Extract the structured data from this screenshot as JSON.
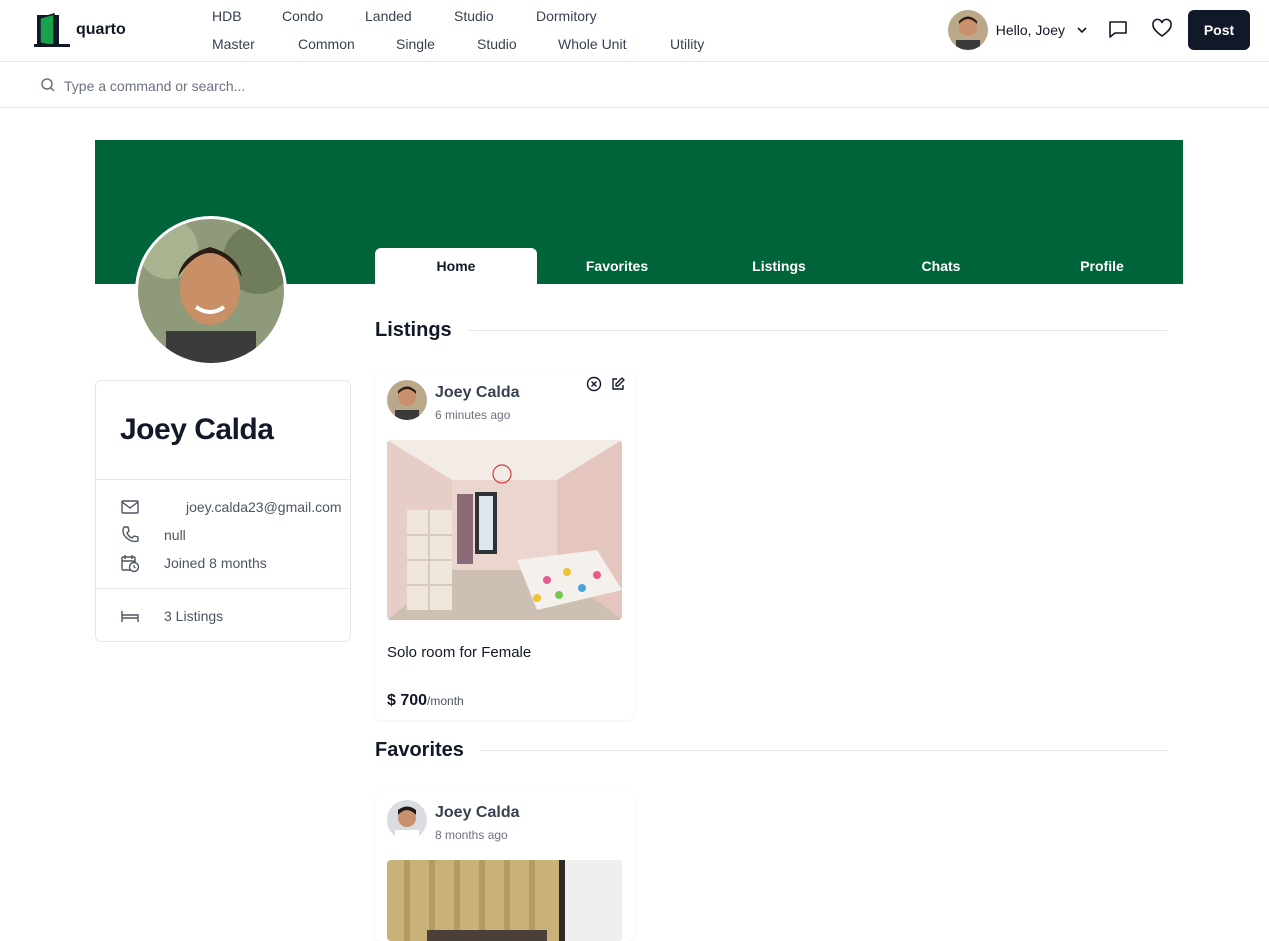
{
  "brand": {
    "name": "quarto"
  },
  "nav": {
    "row1": [
      "HDB",
      "Condo",
      "Landed",
      "Studio",
      "Dormitory"
    ],
    "row2": [
      "Master",
      "Common",
      "Single",
      "Studio",
      "Whole Unit",
      "Utility"
    ]
  },
  "user": {
    "greeting": "Hello, Joey"
  },
  "actions": {
    "post_label": "Post"
  },
  "search": {
    "placeholder": "Type a command or search..."
  },
  "tabs": [
    "Home",
    "Favorites",
    "Listings",
    "Chats",
    "Profile"
  ],
  "active_tab": "Home",
  "banner_color": "#00643a",
  "profile": {
    "name": "Joey Calda",
    "email": "joey.calda23@gmail.com",
    "phone": "null",
    "joined": "Joined 8 months",
    "listings": "3 Listings"
  },
  "sections": {
    "listings_title": "Listings",
    "favorites_title": "Favorites"
  },
  "listing_card": {
    "user": "Joey Calda",
    "time": "6 minutes ago",
    "title": "Solo room for Female",
    "price": "$ 700",
    "per": "/month"
  },
  "favorite_card": {
    "user": "Joey Calda",
    "time": "8 months ago"
  }
}
